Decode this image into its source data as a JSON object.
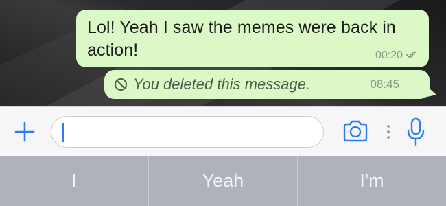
{
  "messages": [
    {
      "text": "Lol! Yeah I saw the memes were back in action!",
      "time": "00:20",
      "status_icon": "double-check-icon"
    },
    {
      "text": "You deleted this message.",
      "time": "08:45",
      "icon": "deleted-icon"
    }
  ],
  "input": {
    "value": "",
    "placeholder": ""
  },
  "toolbar": {
    "plus_icon": "plus-icon",
    "camera_icon": "camera-icon",
    "more_icon": "more-dots-icon",
    "mic_icon": "microphone-icon"
  },
  "predictions": [
    "I",
    "Yeah",
    "I'm"
  ],
  "colors": {
    "bubble": "#dcf8c6",
    "accent": "#2d7cf6",
    "predict_bar": "#aeb2bb"
  }
}
